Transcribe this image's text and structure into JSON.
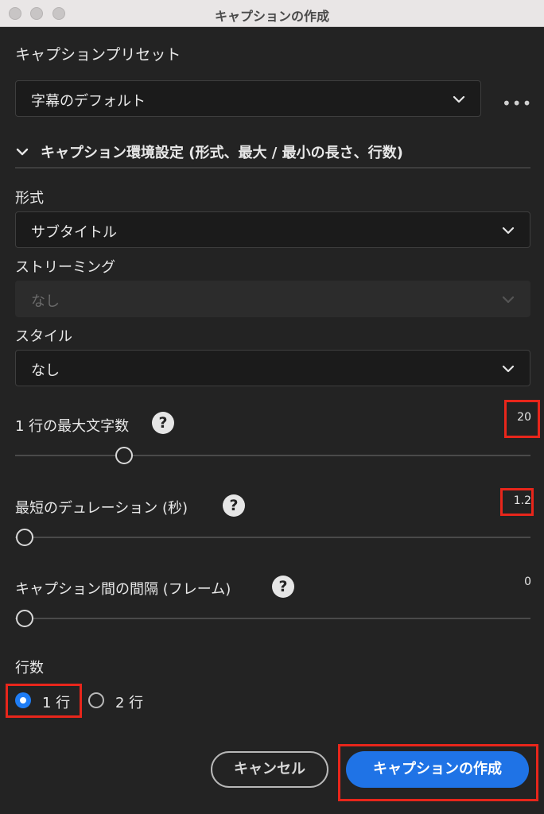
{
  "window": {
    "title": "キャプションの作成"
  },
  "preset": {
    "label": "キャプションプリセット",
    "value": "字幕のデフォルト",
    "more": "•••"
  },
  "settings_section": {
    "title": "キャプション環境設定 (形式、最大 / 最小の長さ、行数)",
    "expanded": true
  },
  "format": {
    "label": "形式",
    "value": "サブタイトル"
  },
  "streaming": {
    "label": "ストリーミング",
    "value": "なし",
    "disabled": true
  },
  "style": {
    "label": "スタイル",
    "value": "なし"
  },
  "max_chars": {
    "label": "1 行の最大文字数",
    "help": "?",
    "value_text": "20",
    "fraction": 0.21
  },
  "min_duration": {
    "label": "最短のデュレーション (秒)",
    "help": "?",
    "value_text": "1.2",
    "fraction": 0.0
  },
  "gap": {
    "label": "キャプション間の間隔 (フレーム)",
    "help": "?",
    "value_text": "0",
    "fraction": 0.0
  },
  "lines": {
    "label": "行数",
    "options": [
      {
        "label": "1 行",
        "selected": true
      },
      {
        "label": "2 行",
        "selected": false
      }
    ]
  },
  "buttons": {
    "cancel": "キャンセル",
    "create": "キャプションの作成"
  },
  "colors": {
    "accent": "#1f73e6",
    "highlight": "#e8261b",
    "background": "#232323"
  }
}
